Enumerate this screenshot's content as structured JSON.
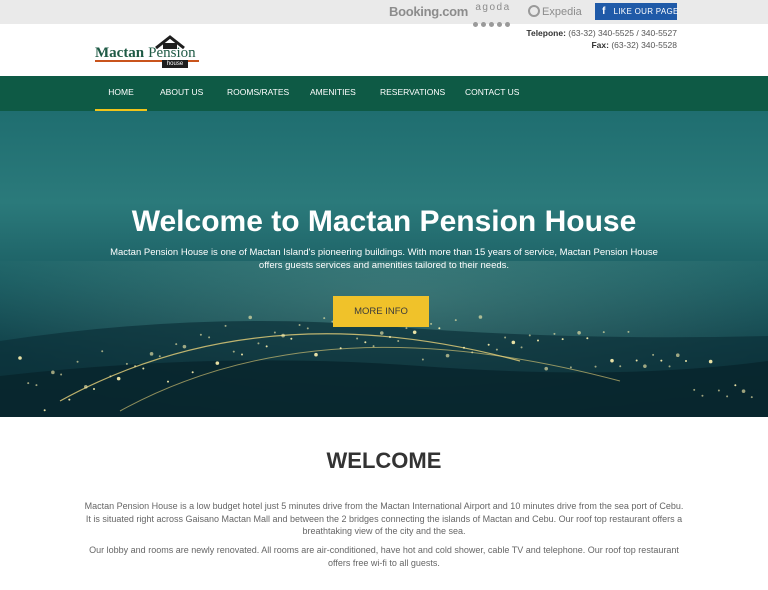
{
  "topbar": {
    "partners": {
      "booking": "Booking.com",
      "agoda": "agoda",
      "expedia": "Expedia"
    },
    "facebook_label": "LIKE OUR PAGE",
    "facebook_icon": "f"
  },
  "logo": {
    "word1": "Mactan",
    "word2": "Pension",
    "tag": "house"
  },
  "contact": {
    "telephone_label": "Telepone:",
    "telephone_value": "(63-32) 340-5525 / 340-5527",
    "fax_label": "Fax:",
    "fax_value": "(63-32) 340-5528"
  },
  "nav": {
    "items": [
      {
        "label": "HOME",
        "active": true
      },
      {
        "label": "ABOUT US"
      },
      {
        "label": "ROOMS/RATES"
      },
      {
        "label": "AMENITIES"
      },
      {
        "label": "RESERVATIONS"
      },
      {
        "label": "CONTACT US"
      }
    ]
  },
  "hero": {
    "title": "Welcome to Mactan Pension House",
    "text": "Mactan Pension House is one of Mactan Island's pioneering buildings. With more than 15 years of service, Mactan Pension House offers guests services and amenities tailored to their needs.",
    "button": "MORE INFO"
  },
  "welcome": {
    "title": "WELCOME",
    "p1": "Mactan Pension House is a low budget hotel just 5 minutes drive from the Mactan International Airport and 10 minutes drive from the sea port of Cebu. It is situated right across Gaisano Mactan Mall and between the 2 bridges connecting the islands of Mactan and Cebu. Our roof top restaurant offers a breathtaking view of the city and the sea.",
    "p2": "Our lobby and rooms are newly renovated. All rooms are air-conditioned, have hot and cold shower, cable TV and telephone. Our roof top restaurant offers free wi-fi to all guests."
  },
  "colors": {
    "nav_bg": "#0e5a45",
    "accent": "#f0c22a",
    "facebook": "#1f5aa8"
  }
}
